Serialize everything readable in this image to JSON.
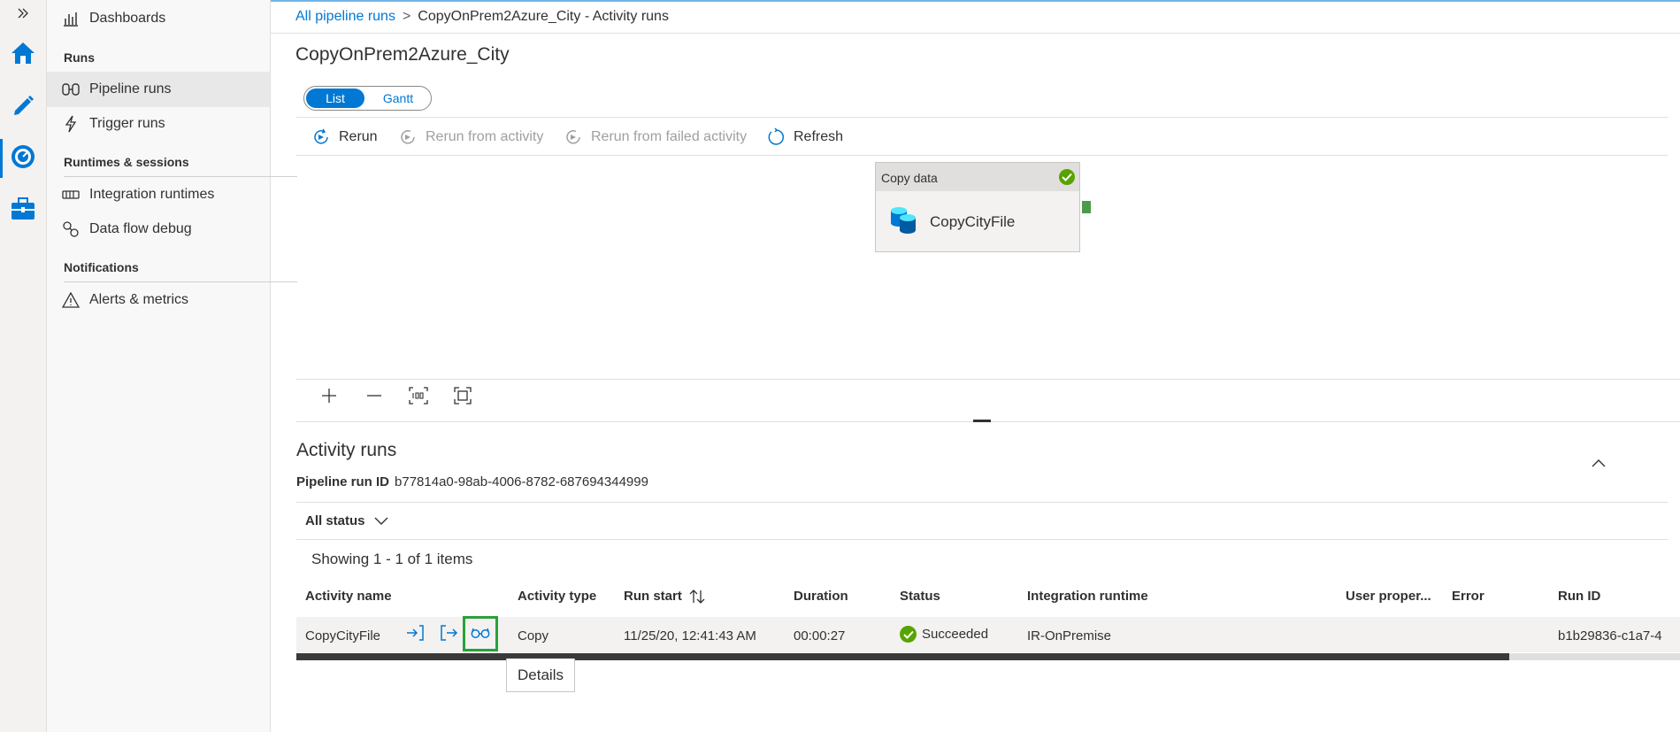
{
  "breadcrumb": {
    "link": "All pipeline runs",
    "separator": ">",
    "current": "CopyOnPrem2Azure_City - Activity runs"
  },
  "nav": {
    "dashboards": "Dashboards",
    "section_runs": "Runs",
    "pipeline_runs": "Pipeline runs",
    "trigger_runs": "Trigger runs",
    "section_runtimes": "Runtimes & sessions",
    "integration_runtimes": "Integration runtimes",
    "data_flow_debug": "Data flow debug",
    "section_notifications": "Notifications",
    "alerts_metrics": "Alerts & metrics"
  },
  "page": {
    "title": "CopyOnPrem2Azure_City",
    "toggle_list": "List",
    "toggle_gantt": "Gantt"
  },
  "toolbar": {
    "rerun": "Rerun",
    "rerun_from_activity": "Rerun from activity",
    "rerun_from_failed": "Rerun from failed activity",
    "refresh": "Refresh"
  },
  "canvas": {
    "activity_type": "Copy data",
    "activity_name": "CopyCityFile",
    "activity_status_color": "#57a300"
  },
  "activity_runs": {
    "title": "Activity runs",
    "pipeline_run_id_label": "Pipeline run ID",
    "pipeline_run_id": "b77814a0-98ab-4006-8782-687694344999",
    "filter": "All status",
    "showing": "Showing 1 - 1 of 1 items",
    "columns": {
      "name": "Activity name",
      "type": "Activity type",
      "run_start": "Run start",
      "duration": "Duration",
      "status": "Status",
      "runtime": "Integration runtime",
      "user_props": "User proper...",
      "error": "Error",
      "run_id": "Run ID"
    },
    "rows": [
      {
        "name": "CopyCityFile",
        "type": "Copy",
        "run_start": "11/25/20, 12:41:43 AM",
        "duration": "00:00:27",
        "status": "Succeeded",
        "runtime": "IR-OnPremise",
        "run_id": "b1b29836-c1a7-4"
      }
    ],
    "tooltip": "Details"
  },
  "colors": {
    "accent": "#0078d4",
    "success": "#57a300",
    "highlight": "#2aa13a"
  }
}
